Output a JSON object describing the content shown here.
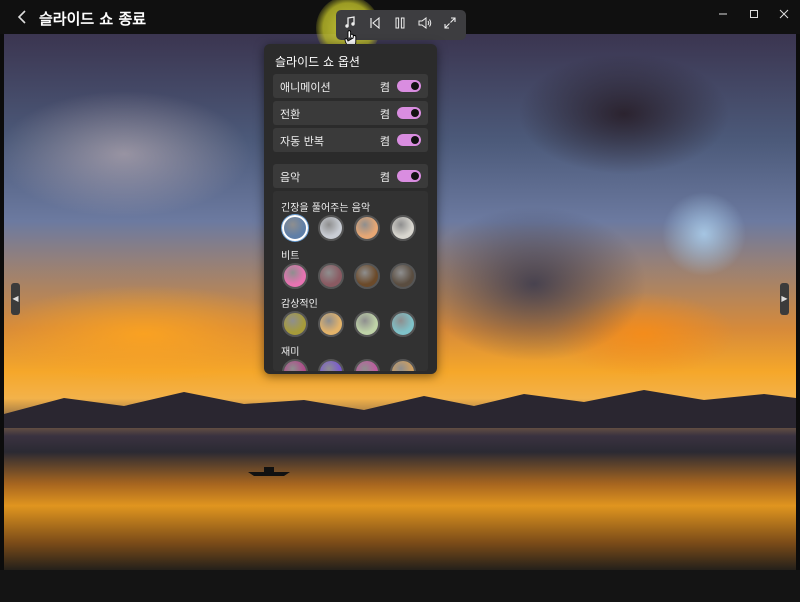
{
  "window": {
    "title": "슬라이드 쇼 종료",
    "back_icon": "chevron-left-icon",
    "controls": [
      "minimize-icon",
      "maximize-icon",
      "close-icon"
    ]
  },
  "toolbar": {
    "buttons": [
      {
        "name": "music-icon"
      },
      {
        "name": "previous-icon"
      },
      {
        "name": "pause-icon"
      },
      {
        "name": "volume-icon"
      },
      {
        "name": "fullscreen-icon"
      }
    ]
  },
  "panel": {
    "title": "슬라이드 쇼 옵션",
    "options": [
      {
        "label": "애니메이션",
        "state": "켬"
      },
      {
        "label": "전환",
        "state": "켬"
      },
      {
        "label": "자동 반복",
        "state": "켬"
      },
      {
        "label": "음악",
        "state": "켬"
      }
    ],
    "categories": [
      {
        "label": "긴장을 풀어주는 음악",
        "thumbs": [
          "#5f7fa8",
          "#c9cdd4",
          "#e7a774",
          "#d8d6cf"
        ]
      },
      {
        "label": "비트",
        "thumbs": [
          "#e873b2",
          "#8a5a62",
          "#6b4a2a",
          "#5a4d40"
        ]
      },
      {
        "label": "감상적인",
        "thumbs": [
          "#a69b3a",
          "#e3b36a",
          "#bfd3a8",
          "#7fc2c9"
        ]
      },
      {
        "label": "재미",
        "thumbs": [
          "#b04a8a",
          "#7a5ad0",
          "#c05aa0",
          "#d0a060"
        ]
      }
    ]
  },
  "colors": {
    "accent": "#d98de0",
    "panel": "#2b2b2b",
    "toolbar": "#3d3d40"
  }
}
